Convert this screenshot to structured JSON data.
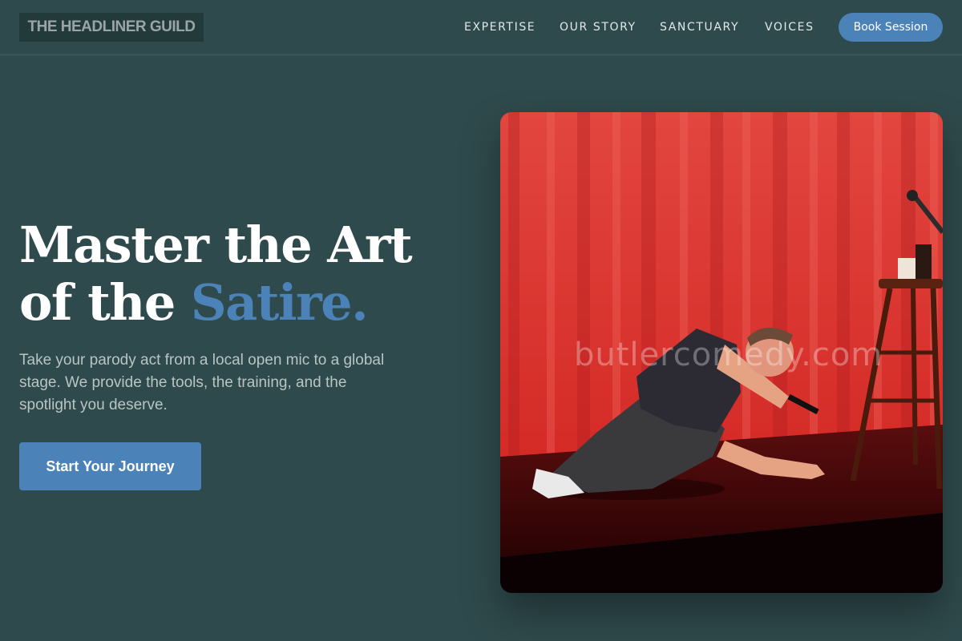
{
  "brand": {
    "logo": "THE HEADLINER GUILD"
  },
  "nav": {
    "items": [
      {
        "label": "EXPERTISE"
      },
      {
        "label": "OUR STORY"
      },
      {
        "label": "SANCTUARY"
      },
      {
        "label": "VOICES"
      }
    ],
    "cta_label": "Book Session"
  },
  "hero": {
    "title_line1": "Master the Art",
    "title_line2_prefix": "of the ",
    "title_accent": "Satire.",
    "subtitle": "Take your parody act from a local open mic to a global stage. We provide the tools, the training, and the spotlight you deserve.",
    "cta_label": "Start Your Journey",
    "image": {
      "watermark": "butlercomedy.com"
    }
  },
  "colors": {
    "background": "#2f4a4c",
    "accent": "#4b82b8",
    "text": "#ffffff"
  }
}
